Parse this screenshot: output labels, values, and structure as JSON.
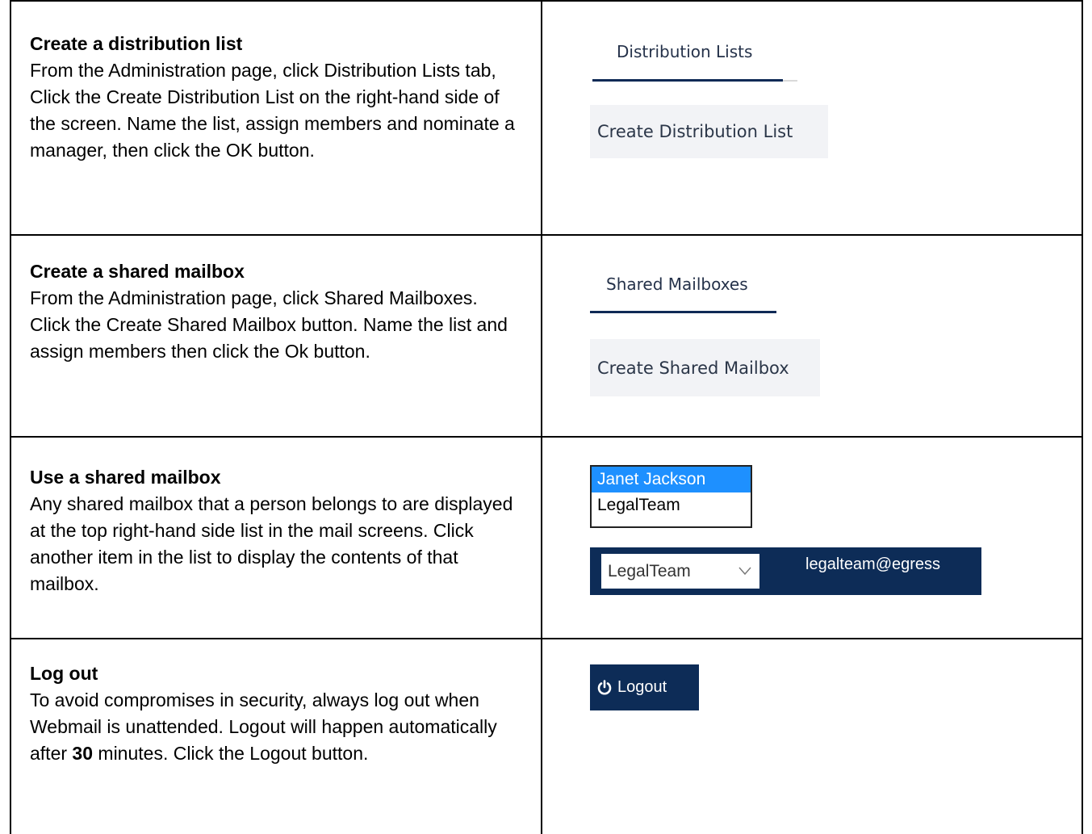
{
  "rows": [
    {
      "title": "Create a distribution list",
      "body": "From the Administration page, click Distribution Lists tab, Click the Create Distribution List on the right-hand side of the screen. Name the list, assign members and nominate a manager, then click the OK button.",
      "tab_label": "Distribution Lists",
      "button_label": "Create Distribution List"
    },
    {
      "title": "Create a shared mailbox",
      "body": "From the Administration page, click Shared Mailboxes. Click the Create Shared Mailbox button. Name the list and assign members then click the Ok button.",
      "tab_label": "Shared Mailboxes",
      "button_label": "Create Shared Mailbox"
    },
    {
      "title": "Use a shared mailbox",
      "body": "Any shared mailbox that a person belongs to are displayed at the top right-hand side list in the mail screens. Click another item in the list to display the contents of that mailbox.",
      "list_items": [
        "Janet Jackson",
        "LegalTeam"
      ],
      "selected_value": "LegalTeam",
      "email": "legalteam@egress"
    },
    {
      "title": "Log out",
      "body_before": "To avoid compromises in security, always log out when Webmail is unattended. Logout will happen automatically after ",
      "body_bold": "30",
      "body_after": " minutes. Click the Logout button.",
      "button_label": "Logout"
    }
  ],
  "colors": {
    "navy": "#0d2c57",
    "selection": "#1e90ff",
    "button_bg": "#f2f3f6"
  }
}
